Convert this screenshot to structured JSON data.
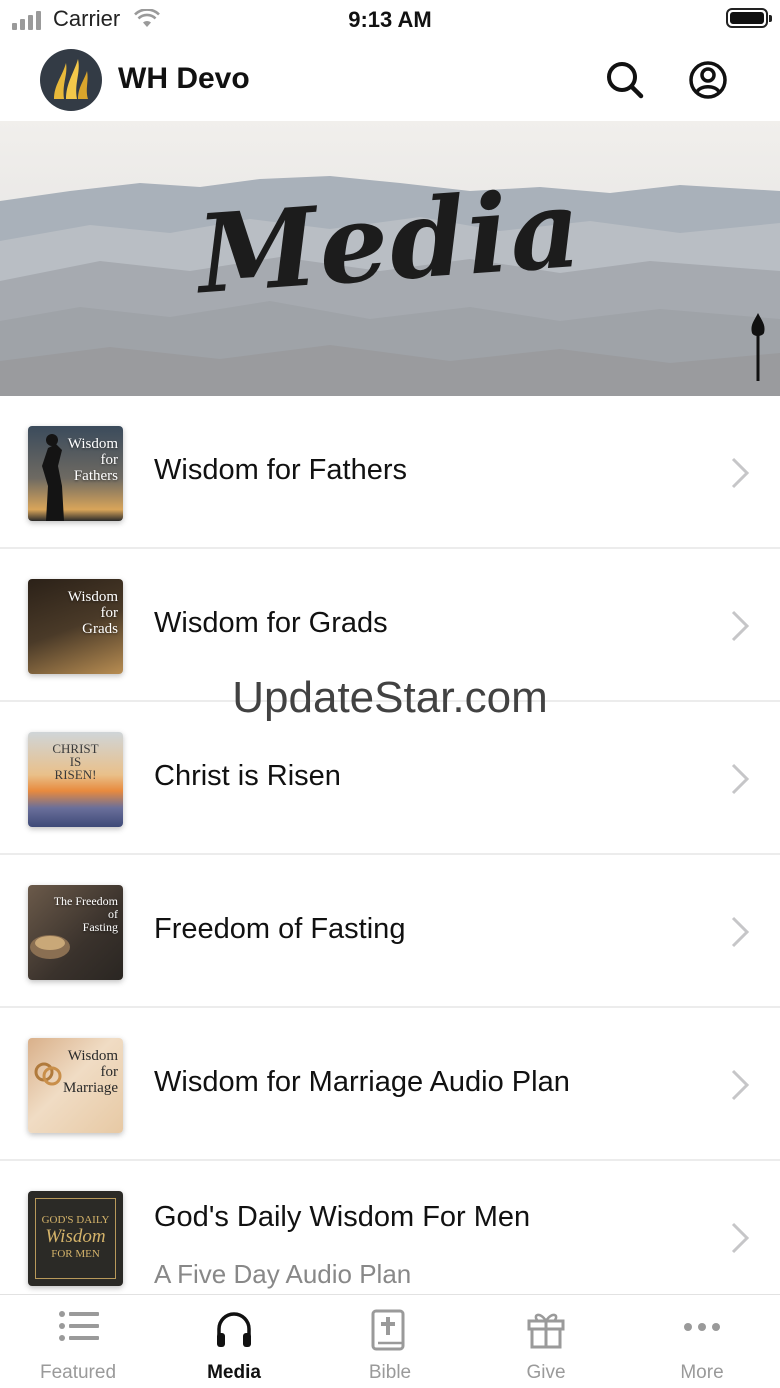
{
  "status_bar": {
    "carrier": "Carrier",
    "time": "9:13 AM"
  },
  "header": {
    "title": "WH Devo"
  },
  "banner": {
    "title": "Media"
  },
  "items": [
    {
      "title": "Wisdom for Fathers",
      "thumb_lines": [
        "Wisdom",
        "for",
        "Fathers"
      ]
    },
    {
      "title": "Wisdom for Grads",
      "thumb_lines": [
        "Wisdom",
        "for",
        "Grads"
      ]
    },
    {
      "title": "Christ is Risen",
      "thumb_lines": [
        "CHRIST",
        "IS",
        "RISEN!"
      ]
    },
    {
      "title": "Freedom of Fasting",
      "thumb_lines": [
        "The Freedom",
        "of",
        "Fasting"
      ]
    },
    {
      "title": "Wisdom for Marriage Audio Plan",
      "thumb_lines": [
        "Wisdom",
        "for",
        "Marriage"
      ]
    },
    {
      "title": "God's Daily Wisdom For Men",
      "subtitle": "A Five Day Audio Plan",
      "thumb_lines": [
        "GOD'S DAILY",
        "Wisdom",
        "FOR MEN"
      ]
    }
  ],
  "watermark": "UpdateStar.com",
  "tabs": [
    {
      "label": "Featured",
      "icon": "list-icon",
      "active": false
    },
    {
      "label": "Media",
      "icon": "headphones-icon",
      "active": true
    },
    {
      "label": "Bible",
      "icon": "bible-icon",
      "active": false
    },
    {
      "label": "Give",
      "icon": "gift-icon",
      "active": false
    },
    {
      "label": "More",
      "icon": "more-icon",
      "active": false
    }
  ],
  "colors": {
    "active": "#111111",
    "inactive": "#9a9a9a",
    "logo_bg": "#333b45",
    "logo_flame": "#e8b93a"
  }
}
